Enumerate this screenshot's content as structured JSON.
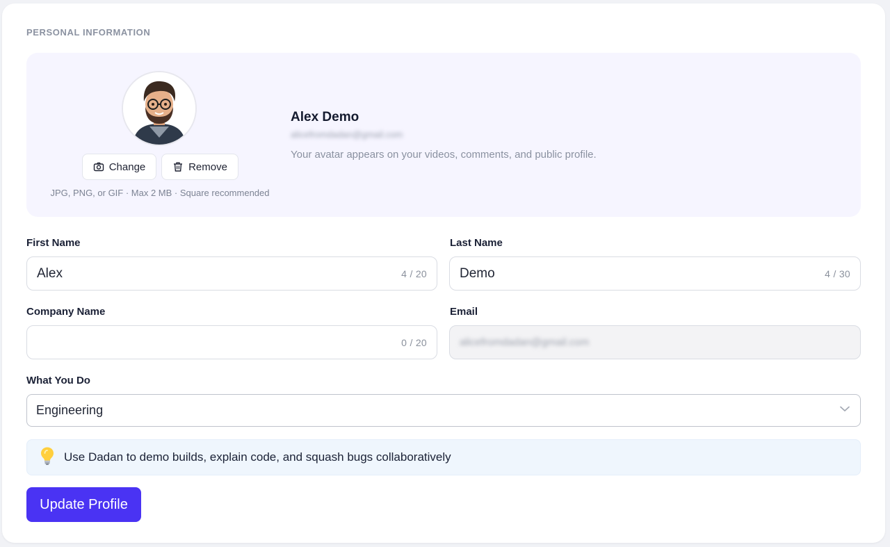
{
  "section": {
    "title": "PERSONAL INFORMATION"
  },
  "avatar": {
    "change_label": "Change",
    "remove_label": "Remove",
    "file_hint": "JPG, PNG, or GIF · Max 2 MB · Square recommended"
  },
  "profile": {
    "name": "Alex Demo",
    "email": "alicefromdadan@gmail.com",
    "note": "Your avatar appears on your videos, comments, and public profile."
  },
  "form": {
    "first_name": {
      "label": "First Name",
      "value": "Alex",
      "counter": "4 / 20"
    },
    "last_name": {
      "label": "Last Name",
      "value": "Demo",
      "counter": "4 / 30"
    },
    "company": {
      "label": "Company Name",
      "value": "",
      "counter": "0 / 20"
    },
    "email": {
      "label": "Email",
      "value": "alicefromdadan@gmail.com"
    },
    "role": {
      "label": "What You Do",
      "value": "Engineering"
    }
  },
  "tip": {
    "icon": "lightbulb-icon",
    "text": "Use Dadan to demo builds, explain code, and squash bugs collaboratively"
  },
  "actions": {
    "submit_label": "Update Profile"
  },
  "colors": {
    "primary": "#4a33f3",
    "avatar_panel": "#f6f5ff",
    "tip_background": "#eff6fd"
  }
}
